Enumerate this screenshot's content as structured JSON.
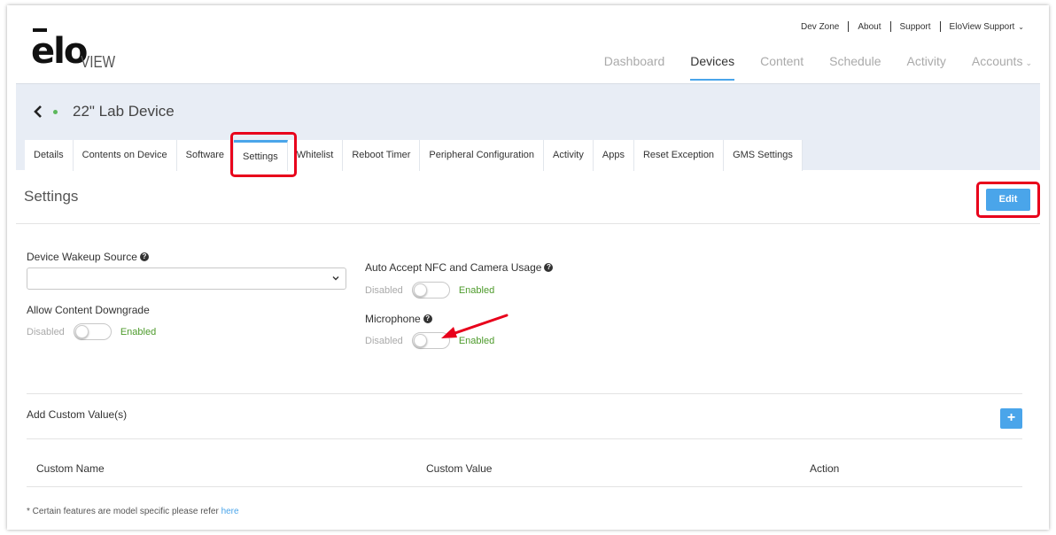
{
  "header": {
    "logo_main": "elo",
    "logo_sub": "VIEW",
    "topnav": [
      "Dev Zone",
      "About",
      "Support"
    ],
    "user_menu": "EloView Support",
    "mainnav": [
      {
        "label": "Dashboard",
        "active": false
      },
      {
        "label": "Devices",
        "active": true
      },
      {
        "label": "Content",
        "active": false
      },
      {
        "label": "Schedule",
        "active": false
      },
      {
        "label": "Activity",
        "active": false
      },
      {
        "label": "Accounts",
        "active": false
      }
    ]
  },
  "device": {
    "title": "22\" Lab Device",
    "status_color": "#5cb85c"
  },
  "tabs": [
    "Details",
    "Contents on Device",
    "Software",
    "Settings",
    "Whitelist",
    "Reboot Timer",
    "Peripheral Configuration",
    "Activity",
    "Apps",
    "Reset Exception",
    "GMS Settings"
  ],
  "active_tab": "Settings",
  "settings": {
    "title": "Settings",
    "edit_label": "Edit",
    "wakeup_source": {
      "label": "Device Wakeup Source",
      "value": ""
    },
    "allow_downgrade": {
      "label": "Allow Content Downgrade",
      "off_label": "Disabled",
      "on_label": "Enabled",
      "enabled": false
    },
    "auto_accept": {
      "label": "Auto Accept NFC and Camera Usage",
      "off_label": "Disabled",
      "on_label": "Enabled",
      "enabled": false
    },
    "microphone": {
      "label": "Microphone",
      "off_label": "Disabled",
      "on_label": "Enabled",
      "enabled": false
    }
  },
  "custom_values": {
    "title": "Add Custom Value(s)",
    "add_label": "+",
    "columns": [
      "Custom Name",
      "Custom Value",
      "Action"
    ]
  },
  "footnote": {
    "text": "* Certain features are model specific please refer ",
    "link": "here"
  },
  "colors": {
    "accent": "#4aa5ea",
    "annotation": "#e8001b",
    "enabled_text": "#4c9a2a"
  }
}
